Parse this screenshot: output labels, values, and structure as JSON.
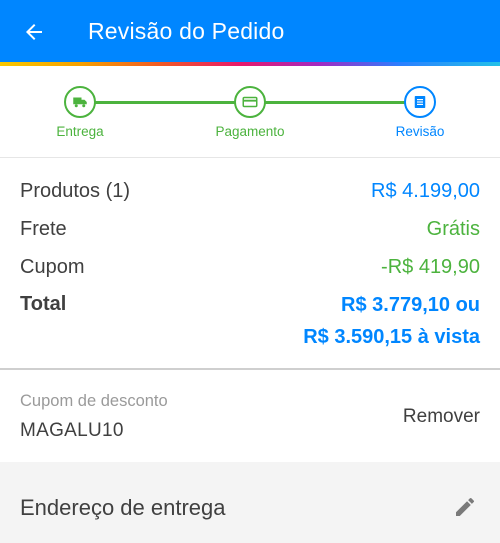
{
  "header": {
    "title": "Revisão do Pedido",
    "back_icon": "arrow-left-icon"
  },
  "stepper": {
    "steps": [
      {
        "label": "Entrega",
        "icon": "truck-icon",
        "state": "done"
      },
      {
        "label": "Pagamento",
        "icon": "credit-card-icon",
        "state": "done"
      },
      {
        "label": "Revisão",
        "icon": "document-icon",
        "state": "current"
      }
    ]
  },
  "summary": {
    "products_label": "Produtos (1)",
    "products_value": "R$ 4.199,00",
    "shipping_label": "Frete",
    "shipping_value": "Grátis",
    "coupon_label": "Cupom",
    "coupon_value": "-R$ 419,90",
    "total_label": "Total",
    "total_value_line1": "R$ 3.779,10 ou",
    "total_value_line2": "R$ 3.590,15 à vista"
  },
  "coupon": {
    "label": "Cupom de desconto",
    "code": "MAGALU10",
    "remove_label": "Remover"
  },
  "address": {
    "title": "Endereço de entrega",
    "edit_icon": "pencil-icon"
  },
  "colors": {
    "primary": "#0086ff",
    "success": "#4cb33e",
    "text": "#404040",
    "muted": "#9a9a9a"
  }
}
